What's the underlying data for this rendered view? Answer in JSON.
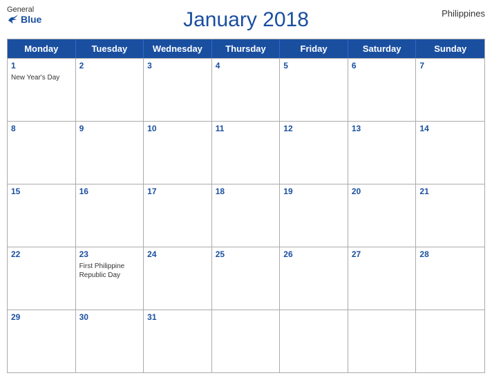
{
  "header": {
    "logo_general": "General",
    "logo_blue": "Blue",
    "title": "January 2018",
    "country": "Philippines"
  },
  "day_headers": [
    "Monday",
    "Tuesday",
    "Wednesday",
    "Thursday",
    "Friday",
    "Saturday",
    "Sunday"
  ],
  "weeks": [
    [
      {
        "day": 1,
        "event": "New Year's Day"
      },
      {
        "day": 2,
        "event": ""
      },
      {
        "day": 3,
        "event": ""
      },
      {
        "day": 4,
        "event": ""
      },
      {
        "day": 5,
        "event": ""
      },
      {
        "day": 6,
        "event": ""
      },
      {
        "day": 7,
        "event": ""
      }
    ],
    [
      {
        "day": 8,
        "event": ""
      },
      {
        "day": 9,
        "event": ""
      },
      {
        "day": 10,
        "event": ""
      },
      {
        "day": 11,
        "event": ""
      },
      {
        "day": 12,
        "event": ""
      },
      {
        "day": 13,
        "event": ""
      },
      {
        "day": 14,
        "event": ""
      }
    ],
    [
      {
        "day": 15,
        "event": ""
      },
      {
        "day": 16,
        "event": ""
      },
      {
        "day": 17,
        "event": ""
      },
      {
        "day": 18,
        "event": ""
      },
      {
        "day": 19,
        "event": ""
      },
      {
        "day": 20,
        "event": ""
      },
      {
        "day": 21,
        "event": ""
      }
    ],
    [
      {
        "day": 22,
        "event": ""
      },
      {
        "day": 23,
        "event": "First Philippine Republic Day"
      },
      {
        "day": 24,
        "event": ""
      },
      {
        "day": 25,
        "event": ""
      },
      {
        "day": 26,
        "event": ""
      },
      {
        "day": 27,
        "event": ""
      },
      {
        "day": 28,
        "event": ""
      }
    ],
    [
      {
        "day": 29,
        "event": ""
      },
      {
        "day": 30,
        "event": ""
      },
      {
        "day": 31,
        "event": ""
      },
      {
        "day": null,
        "event": ""
      },
      {
        "day": null,
        "event": ""
      },
      {
        "day": null,
        "event": ""
      },
      {
        "day": null,
        "event": ""
      }
    ]
  ]
}
